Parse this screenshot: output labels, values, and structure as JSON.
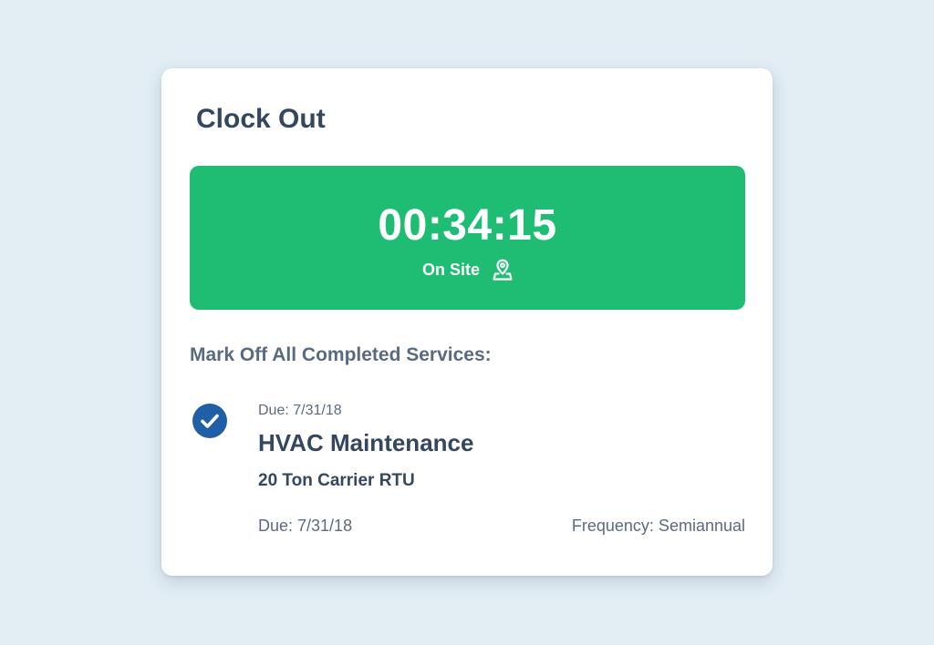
{
  "card": {
    "title": "Clock Out"
  },
  "timer": {
    "elapsed": "00:34:15",
    "status_label": "On Site",
    "status_icon": "map-pin-icon",
    "background_color": "#1ebd73"
  },
  "services": {
    "section_label": "Mark Off All Completed Services:",
    "items": [
      {
        "checked": true,
        "check_icon": "checkmark-circle-icon",
        "due_label": "Due: 7/31/18",
        "name": "HVAC Maintenance",
        "equipment": "20 Ton Carrier RTU",
        "due_footer": "Due: 7/31/18",
        "frequency": "Frequency: Semiannual"
      }
    ]
  },
  "colors": {
    "page_background": "#e2edf4",
    "heading_text": "#34475f",
    "muted_text": "#5a6b80",
    "accent_blue": "#1f5fa6",
    "success_green": "#1ebd73"
  }
}
